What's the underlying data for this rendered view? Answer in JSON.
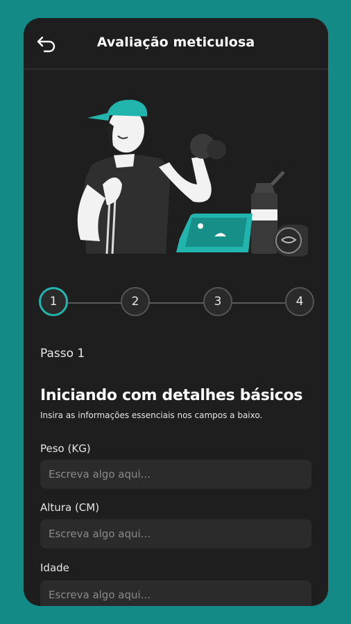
{
  "header": {
    "title": "Avaliação meticulosa",
    "back_icon": "back-arrow-icon"
  },
  "stepper": {
    "steps": [
      "1",
      "2",
      "3",
      "4"
    ],
    "active_step": 1,
    "active_color": "#21b5ae"
  },
  "content": {
    "step_label": "Passo 1",
    "heading": "Iniciando com detalhes básicos",
    "subheading": "Insira as informações essenciais nos campos a baixo."
  },
  "fields": [
    {
      "label": "Peso (KG)",
      "placeholder": "Escreva algo aqui..."
    },
    {
      "label": "Altura (CM)",
      "placeholder": "Escreva algo aqui..."
    },
    {
      "label": "Idade",
      "placeholder": "Escreva algo aqui..."
    }
  ],
  "colors": {
    "background": "#148a86",
    "card": "#1e1e1e",
    "accent": "#21b5ae"
  }
}
